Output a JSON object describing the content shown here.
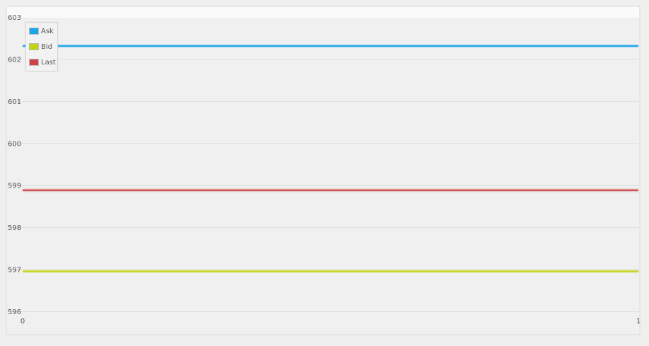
{
  "chart_data": {
    "type": "line",
    "title": "",
    "xlabel": "",
    "ylabel": "",
    "x": [
      0,
      1
    ],
    "xlim": [
      0,
      1
    ],
    "ylim": [
      596,
      603
    ],
    "x_ticks": [
      "0",
      "1"
    ],
    "y_ticks": [
      "603",
      "602",
      "601",
      "600",
      "599",
      "598",
      "597",
      "596"
    ],
    "grid": true,
    "legend_position": "top-left",
    "series": [
      {
        "name": "Ask",
        "values": [
          602.31,
          602.31
        ],
        "color": "#1aa7e8"
      },
      {
        "name": "Bid",
        "values": [
          596.95,
          596.95
        ],
        "color": "#c4d40e"
      },
      {
        "name": "Last",
        "values": [
          598.88,
          598.88
        ],
        "color": "#cc4444"
      }
    ]
  }
}
